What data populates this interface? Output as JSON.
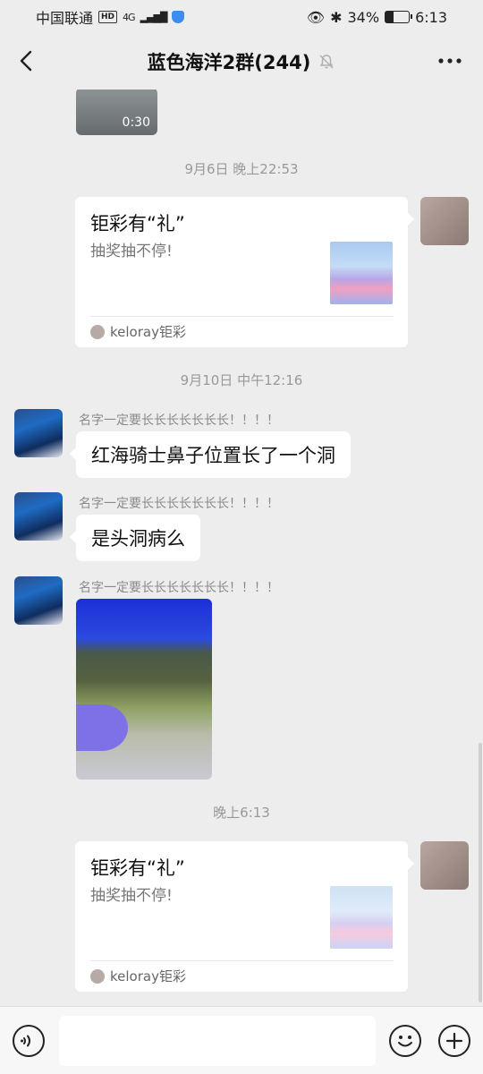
{
  "status_bar": {
    "carrier": "中国联通",
    "hd_badge": "HD",
    "network": "4G",
    "battery": "34%",
    "battery_level": 0.34,
    "time": "6:13"
  },
  "header": {
    "title": "蓝色海洋2群(244)",
    "back_icon": "chevron-left-icon",
    "mute_icon": "bell-off-icon",
    "more_icon": "more-horizontal-icon"
  },
  "messages": [
    {
      "type": "video",
      "sender": "other",
      "duration": "0:30"
    },
    {
      "type": "timestamp",
      "text": "9月6日 晚上22:53"
    },
    {
      "type": "card",
      "sender": "self",
      "title": "钜彩有“礼”",
      "desc": "抽奖抽不停!",
      "source": "keloray钜彩"
    },
    {
      "type": "timestamp",
      "text": "9月10日 中午12:16"
    },
    {
      "type": "text",
      "sender": "other",
      "name": "名字一定要长长长长长长长！！！！",
      "text": "红海骑士鼻子位置长了一个洞"
    },
    {
      "type": "text",
      "sender": "other",
      "name": "名字一定要长长长长长长长！！！！",
      "text": "是头洞病么"
    },
    {
      "type": "image",
      "sender": "other",
      "name": "名字一定要长长长长长长长！！！！"
    },
    {
      "type": "timestamp",
      "text": "晚上6:13"
    },
    {
      "type": "card",
      "sender": "self",
      "title": "钜彩有“礼”",
      "desc": "抽奖抽不停!",
      "source": "keloray钜彩"
    }
  ],
  "input_bar": {
    "voice_icon": "voice-icon",
    "emoji_icon": "emoji-icon",
    "plus_icon": "plus-icon",
    "placeholder": ""
  }
}
